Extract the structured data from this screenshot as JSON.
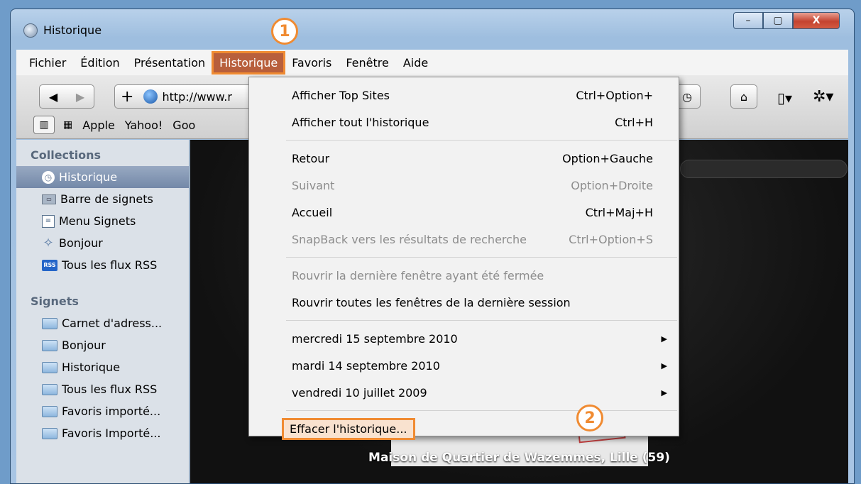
{
  "window": {
    "title": "Historique",
    "controls": [
      "–",
      "▢",
      "X"
    ]
  },
  "menubar": [
    "Fichier",
    "Édition",
    "Présentation",
    "Historique",
    "Favoris",
    "Fenêtre",
    "Aide"
  ],
  "toolbar": {
    "back": "◀",
    "forward": "▶",
    "add": "+",
    "address": "http://www.r",
    "bookmarks": [
      "Apple",
      "Yahoo!",
      "Goo"
    ]
  },
  "sidebar": {
    "collections_header": "Collections",
    "collections": [
      {
        "label": "Historique",
        "icon": "clock-icon"
      },
      {
        "label": "Barre de signets",
        "icon": "bookmarks-bar-icon"
      },
      {
        "label": "Menu Signets",
        "icon": "bookmarks-menu-icon"
      },
      {
        "label": "Bonjour",
        "icon": "bonjour-icon"
      },
      {
        "label": "Tous les flux RSS",
        "icon": "rss-icon"
      }
    ],
    "signets_header": "Signets",
    "signets": [
      "Carnet d'adress...",
      "Bonjour",
      "Historique",
      "Tous les flux RSS",
      "Favoris importé...",
      "Favoris Importé..."
    ]
  },
  "dropdown": {
    "items": [
      {
        "label": "Afficher Top Sites",
        "shortcut": "Ctrl+Option+"
      },
      {
        "label": "Afficher tout l'historique",
        "shortcut": "Ctrl+H"
      },
      {
        "label": "Retour",
        "shortcut": "Option+Gauche"
      },
      {
        "label": "Suivant",
        "shortcut": "Option+Droite"
      },
      {
        "label": "Accueil",
        "shortcut": "Ctrl+Maj+H"
      },
      {
        "label": "SnapBack vers les résultats de recherche",
        "shortcut": "Ctrl+Option+S"
      },
      {
        "label": "Rouvrir la dernière fenêtre ayant été fermée",
        "shortcut": ""
      },
      {
        "label": "Rouvrir toutes les fenêtres de la dernière session",
        "shortcut": ""
      },
      {
        "label": "mercredi 15 septembre 2010",
        "shortcut": ""
      },
      {
        "label": "mardi 14 septembre 2010",
        "shortcut": ""
      },
      {
        "label": "vendredi 10 juillet 2009",
        "shortcut": ""
      },
      {
        "label": "Effacer l'historique...",
        "shortcut": ""
      }
    ]
  },
  "callouts": {
    "one": "1",
    "two": "2"
  },
  "content": {
    "caption": "Maison de Quartier de Wazemmes, Lille (59)"
  },
  "colors": {
    "callout": "#f08b32",
    "menu_active": "#b85f3c"
  }
}
